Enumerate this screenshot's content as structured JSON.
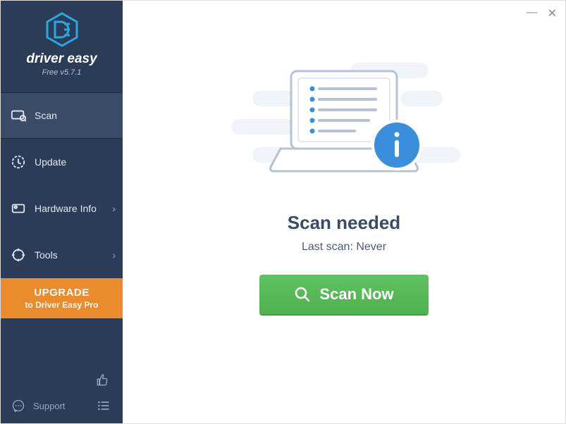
{
  "brand": {
    "name": "driver easy",
    "version": "Free v5.7.1"
  },
  "sidebar": {
    "items": [
      {
        "label": "Scan",
        "active": true,
        "has_submenu": false
      },
      {
        "label": "Update",
        "active": false,
        "has_submenu": false
      },
      {
        "label": "Hardware Info",
        "active": false,
        "has_submenu": true
      },
      {
        "label": "Tools",
        "active": false,
        "has_submenu": true
      }
    ],
    "upgrade": {
      "title": "UPGRADE",
      "subtitle": "to Driver Easy Pro"
    },
    "support_label": "Support"
  },
  "main": {
    "heading": "Scan needed",
    "last_scan": "Last scan: Never",
    "scan_button": "Scan Now"
  },
  "window": {
    "minimize": "—",
    "close": "✕"
  }
}
